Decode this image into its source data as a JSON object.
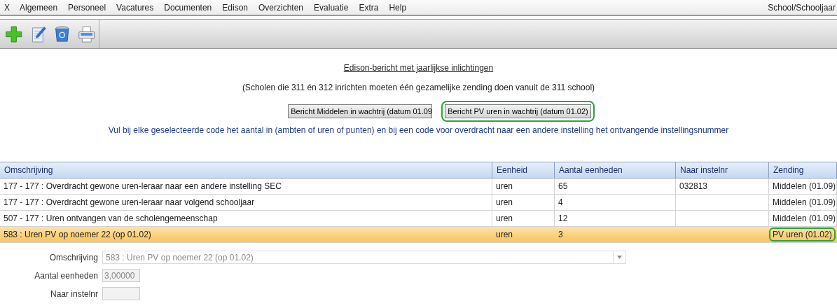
{
  "menu": {
    "close": "X",
    "items": [
      "Algemeen",
      "Personeel",
      "Vacatures",
      "Documenten",
      "Edison",
      "Overzichten",
      "Evaluatie",
      "Extra",
      "Help"
    ],
    "context": "School/Schooljaar"
  },
  "toolbar": [
    {
      "kind": "add"
    },
    {
      "kind": "edit"
    },
    {
      "kind": "delete"
    },
    {
      "kind": "print"
    }
  ],
  "heading": "Edison-bericht met jaarlijkse inlichtingen",
  "note": "(Scholen die 311 én 312 inrichten moeten één gezamelijke zending doen vanuit de 311 school)",
  "buttons": [
    {
      "label": "Bericht Middelen in wachtrij (datum 01.09",
      "highlighted": false
    },
    {
      "label": "Bericht PV uren in wachtrij (datum 01.02)",
      "highlighted": true
    }
  ],
  "instruction": "Vul bij elke geselecteerde code het aantal in (ambten of uren of punten) en bij een code voor overdracht naar een andere instelling het ontvangende instellingsnummer",
  "table": {
    "columns": [
      "Omschrijving",
      "Eenheid",
      "Aantal eenheden",
      "Naar instelnr",
      "Zending"
    ],
    "rows": [
      {
        "selected": false,
        "highlighted": false,
        "cells": [
          "177 - 177 : Overdracht gewone uren-leraar naar een andere instelling SEC",
          "uren",
          "65",
          "032813",
          "Middelen (01.09)"
        ]
      },
      {
        "selected": false,
        "highlighted": false,
        "cells": [
          "177 - 177 : Overdracht gewone uren-leraar naar volgend schooljaar",
          "uren",
          "4",
          "",
          "Middelen (01.09)"
        ]
      },
      {
        "selected": false,
        "highlighted": false,
        "cells": [
          "507 - 177 : Uren ontvangen van de scholengemeenschap",
          "uren",
          "12",
          "",
          "Middelen (01.09)"
        ]
      },
      {
        "selected": true,
        "highlighted": true,
        "cells": [
          "583 : Uren PV op noemer 22 (op 01.02)",
          "uren",
          "3",
          "",
          "PV uren (01.02)"
        ]
      }
    ]
  },
  "form": {
    "omschrijving": {
      "label": "Omschrijving",
      "value": "583 : Uren PV op noemer 22 (op 01.02)"
    },
    "aantal": {
      "label": "Aantal eenheden",
      "value": "3,00000"
    },
    "naar": {
      "label": "Naar instelnr"
    }
  }
}
